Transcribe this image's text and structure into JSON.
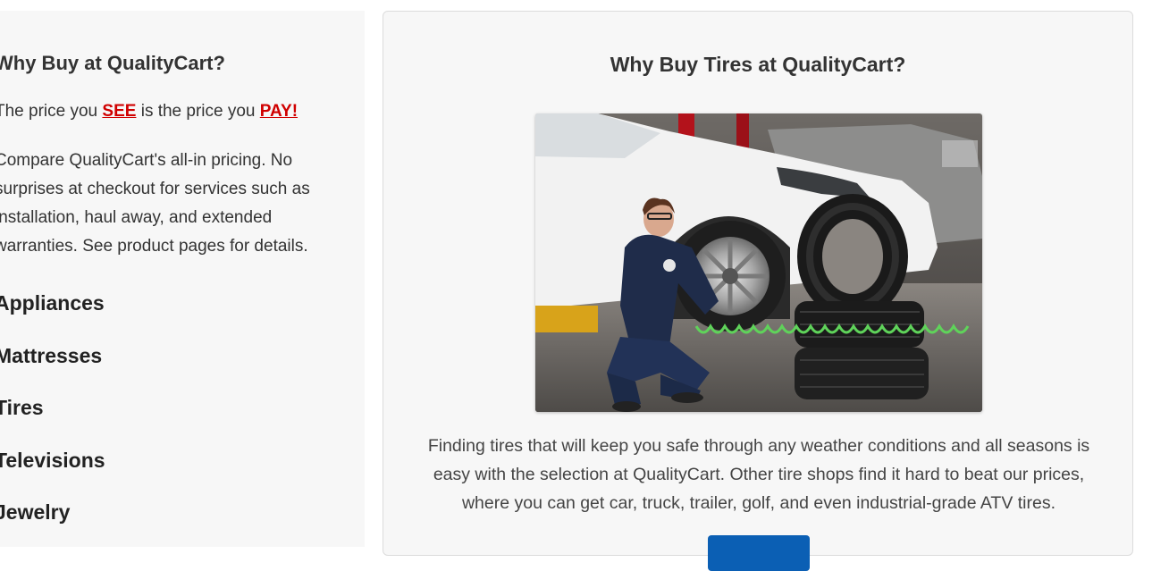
{
  "left_panel": {
    "title": "Why Buy at QualityCart?",
    "price_line": {
      "part1": "The price you ",
      "see": "SEE",
      "part2": " is the price you ",
      "pay": "PAY!"
    },
    "description": "Compare QualityCart's all-in pricing. No surprises at checkout for services such as installation, haul away, and extended warranties. See product pages for details.",
    "categories": [
      "Appliances",
      "Mattresses",
      "Tires",
      "Televisions",
      "Jewelry"
    ]
  },
  "right_card": {
    "title": "Why Buy Tires at QualityCart?",
    "photo_description": "technician installing tire on white car",
    "body": "Finding tires that will keep you safe through any weather conditions and all seasons is easy with the selection at QualityCart. Other tire shops find it hard to beat our prices, where you can get car, truck, trailer, golf, and even industrial-grade ATV tires."
  },
  "colors": {
    "accent_red": "#d00000",
    "button_blue": "#0b5fb4",
    "panel_bg": "#f7f7f7"
  }
}
